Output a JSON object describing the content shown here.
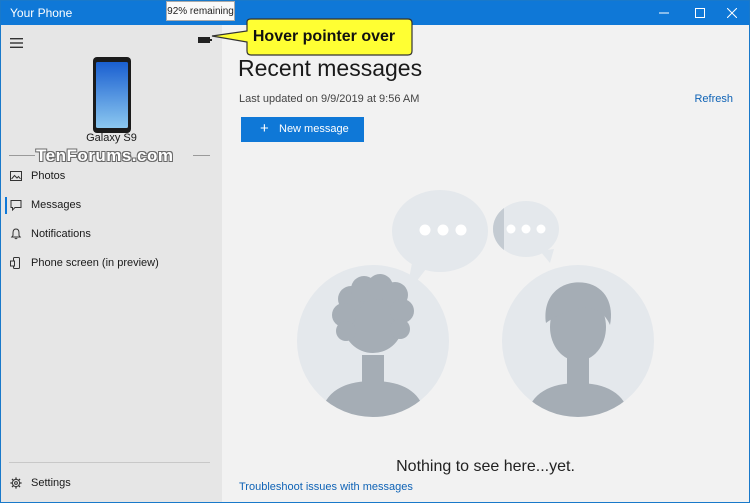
{
  "window": {
    "title": "Your Phone"
  },
  "caption_buttons": {
    "minimize": "—",
    "maximize": "☐",
    "close": "✕"
  },
  "sidebar": {
    "device_name": "Galaxy S9",
    "watermark": "TenForums.com",
    "battery_tooltip": "92% remaining",
    "items": [
      {
        "label": "Photos",
        "icon": "photos-icon"
      },
      {
        "label": "Messages",
        "icon": "messages-icon",
        "selected": true
      },
      {
        "label": "Notifications",
        "icon": "bell-icon"
      },
      {
        "label": "Phone screen (in preview)",
        "icon": "phone-screen-icon"
      }
    ],
    "settings_label": "Settings"
  },
  "callout": {
    "text": "Hover pointer over"
  },
  "main": {
    "title": "Recent messages",
    "last_updated": "Last updated on 9/9/2019 at 9:56 AM",
    "refresh_label": "Refresh",
    "new_message_label": "New message",
    "empty_text": "Nothing to see here...yet.",
    "troubleshoot_link": "Troubleshoot issues with messages"
  },
  "colors": {
    "accent": "#0f78d7",
    "sidebar_bg": "#e6e6e6",
    "main_bg": "#f2f2f2",
    "callout_fill": "#ffff33",
    "illustration": "#a5adb5"
  }
}
